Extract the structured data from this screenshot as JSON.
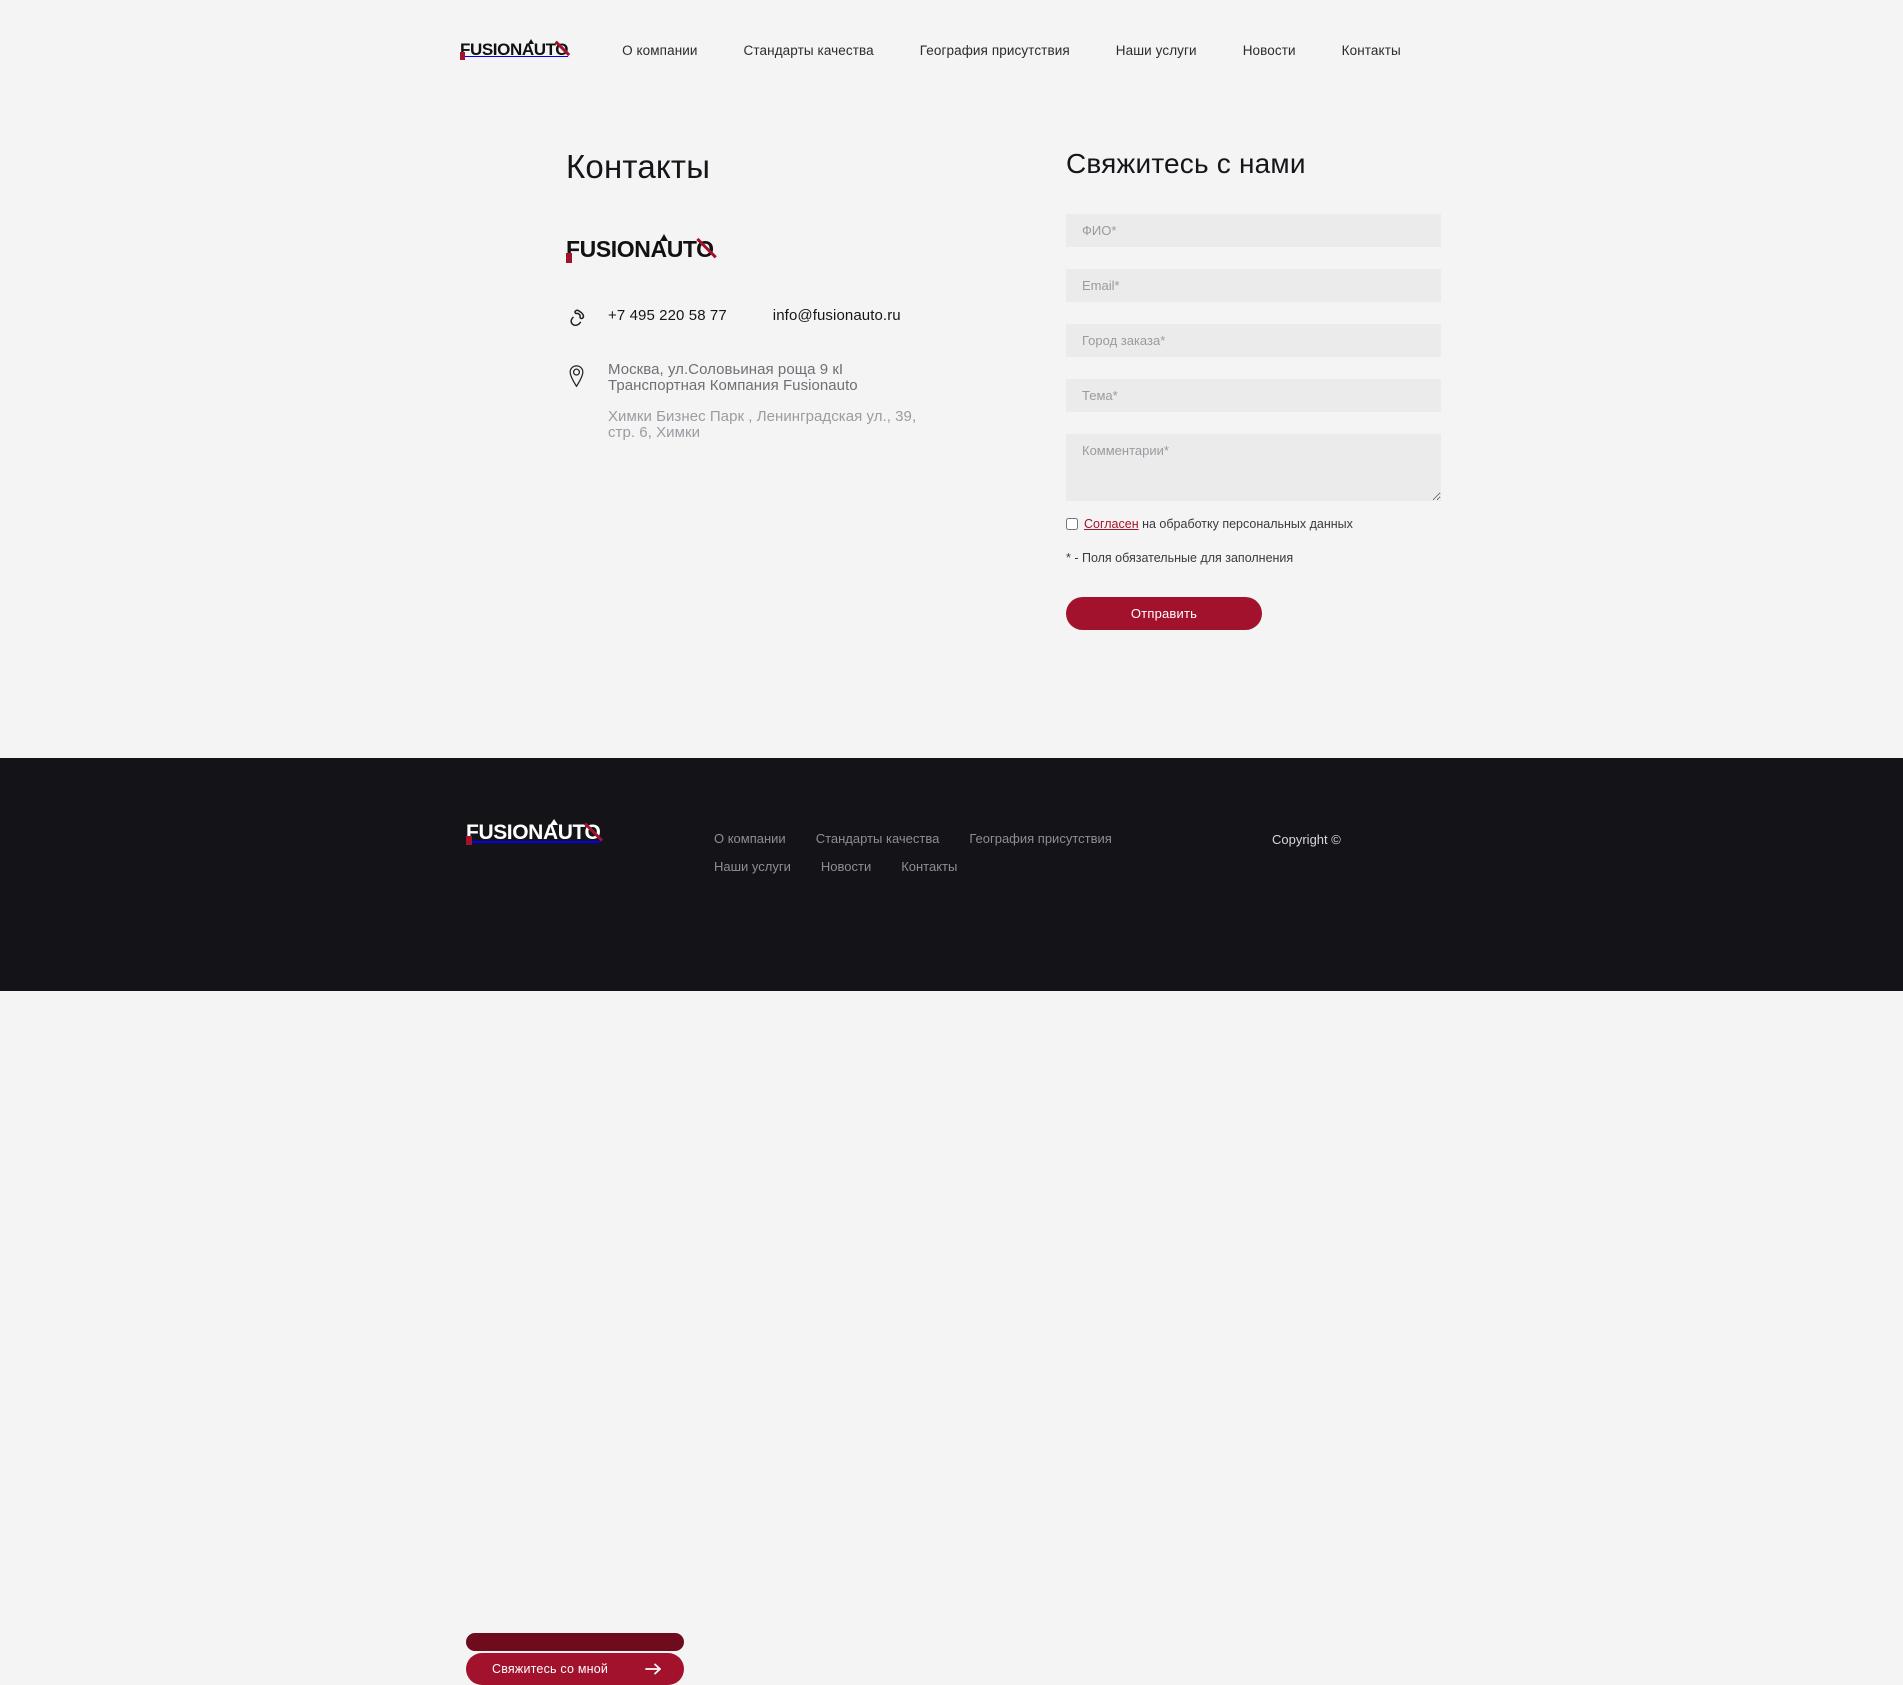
{
  "brand": {
    "logo_text_f": "F",
    "logo_text_rest": "USIONAUTO",
    "accent_color": "#a3122c",
    "dark_color": "#131318"
  },
  "header": {
    "nav": [
      {
        "label": "О компании"
      },
      {
        "label": "Стандарты качества"
      },
      {
        "label": "География присутствия"
      },
      {
        "label": "Наши услуги"
      },
      {
        "label": "Новости"
      },
      {
        "label": "Контакты"
      }
    ]
  },
  "contacts": {
    "title": "Контакты",
    "phone": "+7 495 220 58 77",
    "email": "info@fusionauto.ru",
    "phone_icon": "phone-icon",
    "address_icon": "map-pin-icon",
    "address_primary": "Москва, ул.Соловьиная роща 9 кI\nТранспортная Компания Fusionauto",
    "address_secondary": "Химки Бизнес Парк , Ленинградская ул., 39,\nстр. 6, Химки"
  },
  "form": {
    "title": "Свяжитесь с нами",
    "fields": [
      {
        "name": "fullname",
        "placeholder": "ФИО*",
        "value": ""
      },
      {
        "name": "email",
        "placeholder": "Email*",
        "value": ""
      },
      {
        "name": "city",
        "placeholder": "Город заказа*",
        "value": ""
      },
      {
        "name": "subject",
        "placeholder": "Тема*",
        "value": ""
      }
    ],
    "comment_placeholder": "Комментарии*",
    "comment_value": "",
    "consent_link": "Согласен",
    "consent_rest": " на обработку персональных данных",
    "consent_checked": false,
    "required_note": "* - Поля обязательные для заполнения",
    "submit_label": "Отправить"
  },
  "footer": {
    "nav": [
      {
        "label": "О компании"
      },
      {
        "label": "Стандарты качества"
      },
      {
        "label": "География присутствия"
      },
      {
        "label": "Наши услуги"
      },
      {
        "label": "Новости"
      },
      {
        "label": "Контакты"
      }
    ],
    "copyright": "Copyright ©",
    "cta_label": "Свяжитесь со мной",
    "cta_icon": "arrow-right-icon"
  }
}
